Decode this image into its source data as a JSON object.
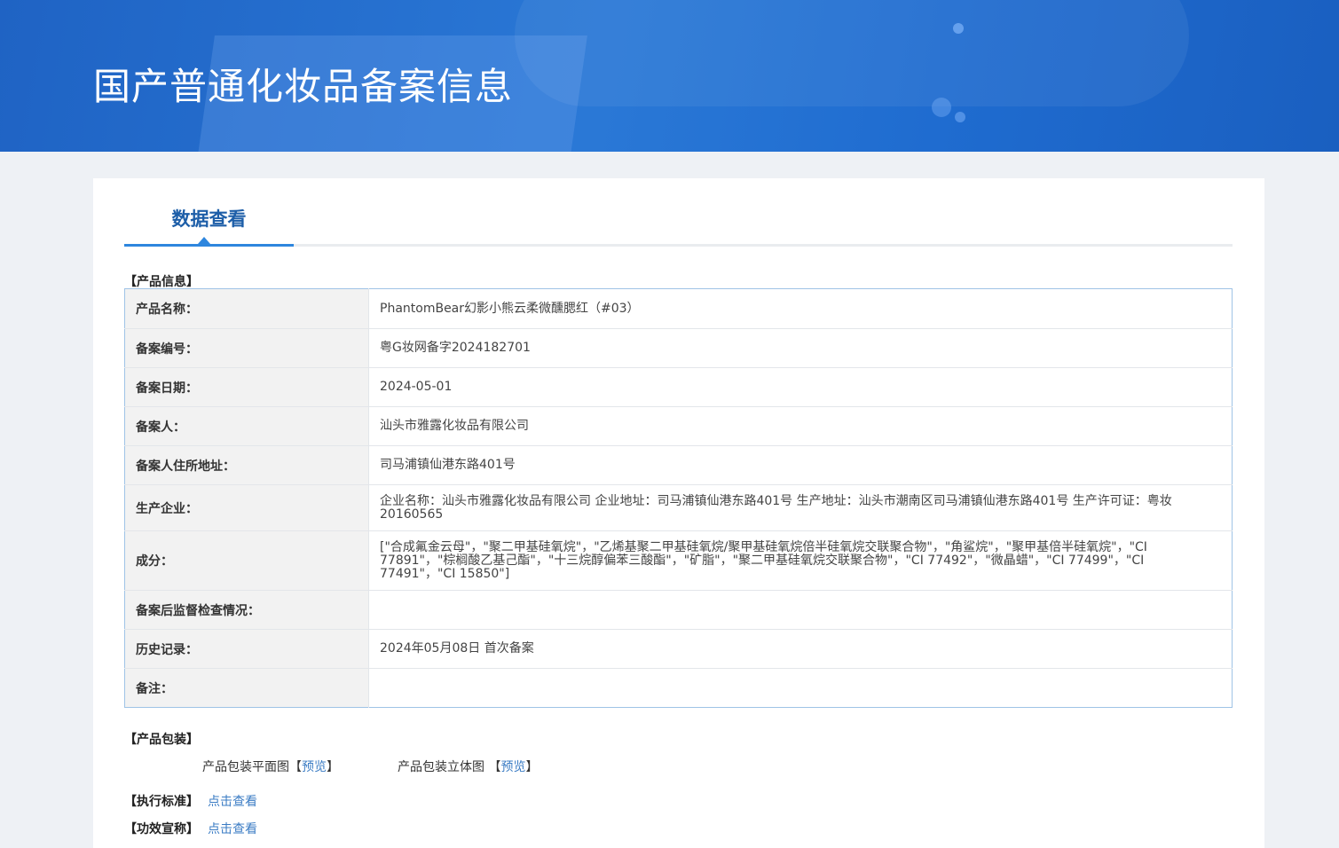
{
  "header": {
    "title": "国产普通化妆品备案信息"
  },
  "tabs": [
    {
      "label": "数据查看"
    }
  ],
  "product_info": {
    "section_label": "【产品信息】",
    "rows": [
      {
        "key": "产品名称：",
        "value": "PhantomBear幻影小熊云柔微醺腮红（#03）"
      },
      {
        "key": "备案编号：",
        "value": "粤G妆网备字2024182701"
      },
      {
        "key": "备案日期：",
        "value": "2024-05-01"
      },
      {
        "key": "备案人：",
        "value": "汕头市雅露化妆品有限公司"
      },
      {
        "key": "备案人住所地址：",
        "value": "司马浦镇仙港东路401号"
      },
      {
        "key": "生产企业：",
        "value": "企业名称：汕头市雅露化妆品有限公司 企业地址：司马浦镇仙港东路401号 生产地址：汕头市潮南区司马浦镇仙港东路401号 生产许可证：粤妆20160565"
      },
      {
        "key": "成分：",
        "value": "[\"合成氟金云母\"，\"聚二甲基硅氧烷\"，\"乙烯基聚二甲基硅氧烷/聚甲基硅氧烷倍半硅氧烷交联聚合物\"，\"角鲨烷\"，\"聚甲基倍半硅氧烷\"，\"CI 77891\"，\"棕榈酸乙基己酯\"，\"十三烷醇偏苯三酸酯\"，\"矿脂\"，\"聚二甲基硅氧烷交联聚合物\"，\"CI 77492\"，\"微晶蜡\"，\"CI 77499\"，\"CI 77491\"，\"CI 15850\"]"
      },
      {
        "key": "备案后监督检查情况：",
        "value": ""
      },
      {
        "key": "历史记录：",
        "value": "2024年05月08日 首次备案"
      },
      {
        "key": "备注：",
        "value": ""
      }
    ]
  },
  "packaging": {
    "section_label": "【产品包装】",
    "flat_label": "产品包装平面图",
    "solid_label": "产品包装立体图",
    "preview_link": "预览",
    "bracket_open": "【",
    "bracket_close": "】"
  },
  "standard": {
    "label": "【执行标准】",
    "link": "点击查看"
  },
  "efficacy": {
    "label": "【功效宣称】",
    "link": "点击查看"
  },
  "colors": {
    "banner": "#2a78d6",
    "accent": "#2e86de",
    "link": "#3b7cc4",
    "border": "#9fc3e6"
  }
}
